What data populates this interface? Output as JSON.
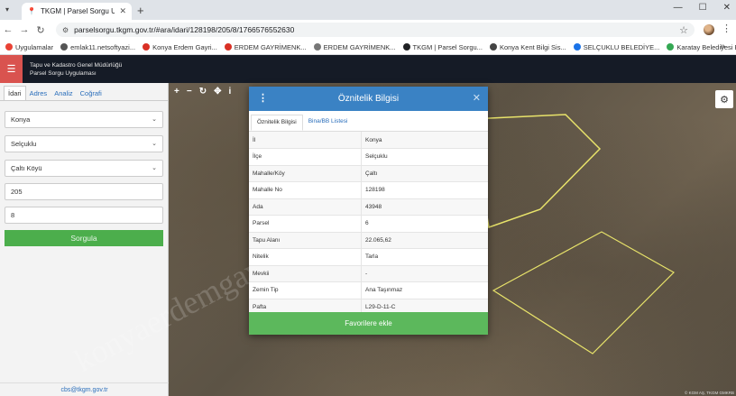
{
  "browser": {
    "tab_title": "TKGM | Parsel Sorgu Uygulaması",
    "url": "parselsorgu.tkgm.gov.tr/#ara/idari/128198/205/8/1766576552630",
    "bookmarks": [
      {
        "label": "Uygulamalar",
        "color": "#e94235"
      },
      {
        "label": "emlak11.netsoftyazi...",
        "color": "#555555"
      },
      {
        "label": "Konya Erdem Gayri...",
        "color": "#d93025"
      },
      {
        "label": "ERDEM GAYRİMENK...",
        "color": "#d93025"
      },
      {
        "label": "ERDEM GAYRİMENK...",
        "color": "#777777"
      },
      {
        "label": "TKGM | Parsel Sorgu...",
        "color": "#202124"
      },
      {
        "label": "Konya Kent Bilgi Sis...",
        "color": "#444444"
      },
      {
        "label": "SELÇUKLU BELEDİYE...",
        "color": "#1a73e8"
      },
      {
        "label": "Karatay Belediyesi E...",
        "color": "#34a853"
      }
    ]
  },
  "header": {
    "line1": "Tapu ve Kadastro Genel Müdürlüğü",
    "line2": "Parsel Sorgu Uygulaması"
  },
  "sidebar": {
    "tabs": [
      "İdari",
      "Adres",
      "Analiz",
      "Coğrafi"
    ],
    "province": "Konya",
    "district": "Selçuklu",
    "neighborhood": "Çaltı Köyü",
    "block": "205",
    "parcel": "8",
    "query_label": "Sorgula",
    "footer_email": "cbs@tkgm.gov.tr"
  },
  "map": {
    "attribution": "© KGM AŞ, TKGM GMKRB",
    "watermark": "konyaerdemgayrimenkul.com"
  },
  "modal": {
    "title": "Öznitelik Bilgisi",
    "tabs": [
      "Öznitelik Bilgisi",
      "Bina/BB Listesi"
    ],
    "rows": [
      {
        "k": "İl",
        "v": "Konya"
      },
      {
        "k": "İlçe",
        "v": "Selçuklu"
      },
      {
        "k": "Mahalle/Köy",
        "v": "Çaltı"
      },
      {
        "k": "Mahalle No",
        "v": "128198"
      },
      {
        "k": "Ada",
        "v": "43948"
      },
      {
        "k": "Parsel",
        "v": "6"
      },
      {
        "k": "Tapu Alanı",
        "v": "22.065,62"
      },
      {
        "k": "Nitelik",
        "v": "Tarla"
      },
      {
        "k": "Mevkii",
        "v": "-"
      },
      {
        "k": "Zemin Tip",
        "v": "Ana Taşınmaz"
      },
      {
        "k": "Pafta",
        "v": "L29-D-11-C"
      }
    ],
    "fav_label": "Favorilere ekle"
  }
}
